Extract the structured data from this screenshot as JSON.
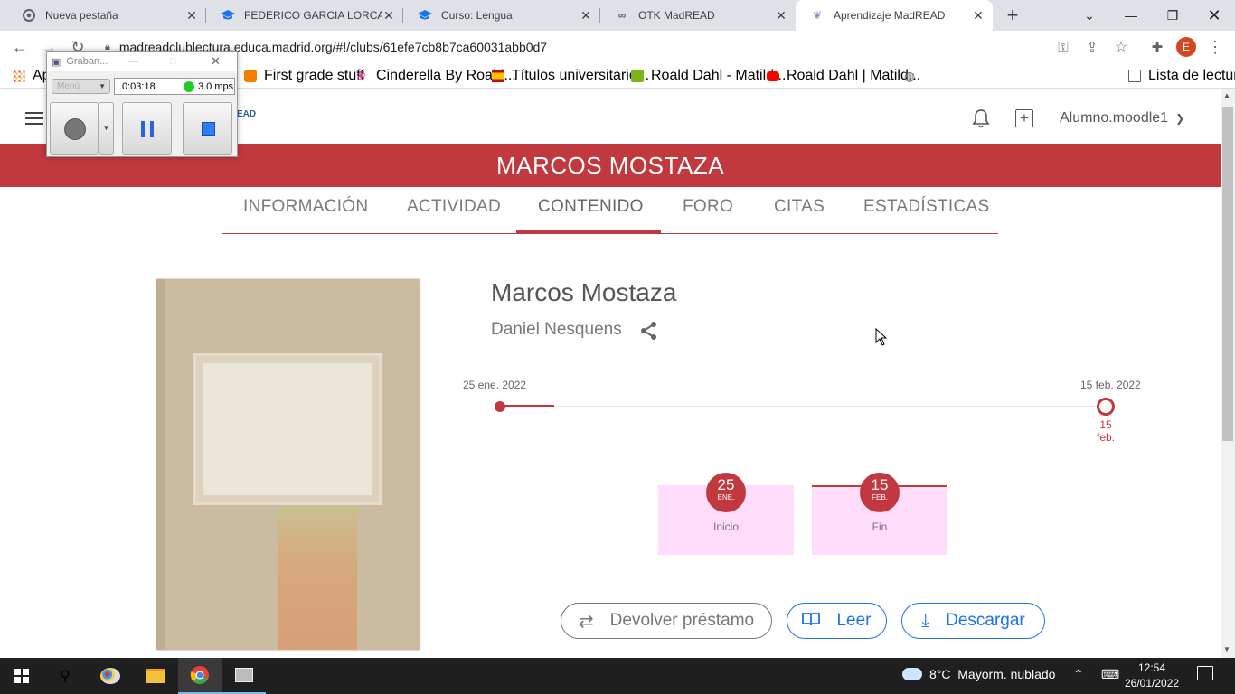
{
  "browser": {
    "tabs": [
      {
        "title": "Nueva pestaña",
        "icon": "chrome-icon"
      },
      {
        "title": "FEDERICO GARCIA LORCA",
        "icon": "graduation-cap-icon"
      },
      {
        "title": "Curso: Lengua",
        "icon": "graduation-cap-icon"
      },
      {
        "title": "OTK MadREAD",
        "icon": "link-icon"
      },
      {
        "title": "Aprendizaje MadREAD",
        "icon": "madread-icon"
      }
    ],
    "new_tab": "+",
    "url": "madreadclublectura.educa.madrid.org/#!/clubs/61efe7cb8b7ca60031abb0d7",
    "profile_initial": "E",
    "bookmarks": [
      {
        "label": "Ap",
        "icon": "apps-grid-icon"
      },
      {
        "label": "First grade stuff",
        "icon": "blogger-icon"
      },
      {
        "label": "Cinderella By Roald...",
        "icon": "flower-icon"
      },
      {
        "label": "Títulos universitario...",
        "icon": "spain-shield-icon"
      },
      {
        "label": "Roald Dahl - Matild...",
        "icon": "book-green-icon"
      },
      {
        "label": "Roald Dahl | Matild...",
        "icon": "youtube-icon"
      }
    ],
    "reading_list": "Lista de lectura"
  },
  "recorder": {
    "title": "Graban...",
    "menu": "Menú",
    "time": "0:03:18",
    "rate": "3.0 mps"
  },
  "header": {
    "user": "Alumno.moodle1",
    "logo_fragment": "EAD"
  },
  "club": {
    "banner_title": "MARCOS MOSTAZA",
    "tabs": [
      "INFORMACIÓN",
      "ACTIVIDAD",
      "CONTENIDO",
      "FORO",
      "CITAS",
      "ESTADÍSTICAS"
    ],
    "active_tab": "CONTENIDO"
  },
  "book": {
    "title": "Marcos Mostaza",
    "author": "Daniel Nesquens"
  },
  "timeline": {
    "start_label": "25 ene. 2022",
    "end_label": "15 feb. 2022",
    "end_day": "15",
    "end_month": "feb.",
    "progress_fraction": 0.09
  },
  "cards": [
    {
      "day": "25",
      "month": "ENE.",
      "label": "Inicio"
    },
    {
      "day": "15",
      "month": "FEB.",
      "label": "Fin"
    }
  ],
  "actions": [
    {
      "label": "Devolver préstamo",
      "icon": "swap-arrows-icon"
    },
    {
      "label": "Leer",
      "icon": "open-book-icon"
    },
    {
      "label": "Descargar",
      "icon": "download-icon"
    }
  ],
  "taskbar": {
    "weather": "8°C  Mayorm. nublado",
    "time": "12:54",
    "date": "26/01/2022"
  },
  "colors": {
    "accent": "#c1393f",
    "blue": "#1a73e8",
    "card_bg": "#ffdcfa"
  }
}
